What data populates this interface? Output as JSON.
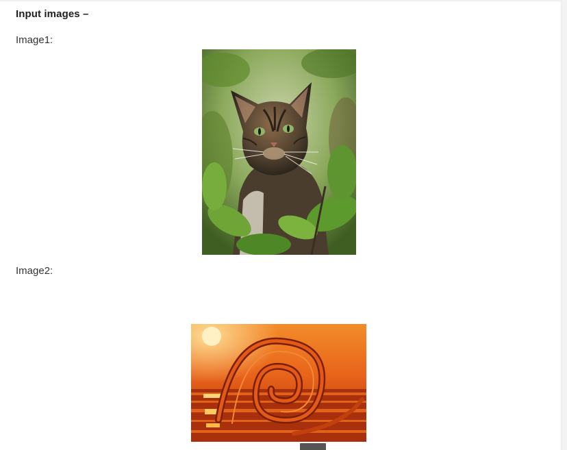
{
  "section": {
    "heading": "Input images –",
    "image1_label": "Image1:",
    "image2_label": "Image2:"
  },
  "images": {
    "image1": {
      "subject": "tabby-cat-in-foliage",
      "colors": {
        "foliage": "#6f9a3c",
        "fur": "#5a4a36",
        "eyes": "#7fa860"
      }
    },
    "image2": {
      "subject": "sunset-swirl-over-sea",
      "colors": {
        "sky": "#e8621a",
        "sun": "#fff1c4",
        "swirl": "#b83410"
      }
    }
  }
}
